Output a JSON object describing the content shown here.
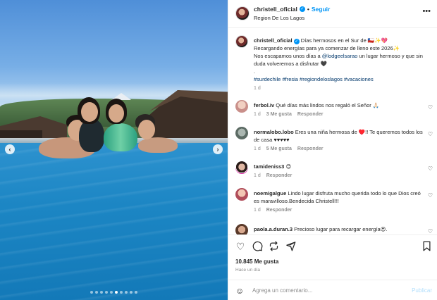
{
  "post": {
    "username": "christell_oficial",
    "follow_label": "Seguir",
    "location": "Region De Los Lagos",
    "more_icon": "more-horizontal-icon",
    "carousel": {
      "total_slides": 10,
      "active_index": 5
    }
  },
  "caption": {
    "username": "christell_oficial",
    "line1": "Días hermosos en el Sur de 🇨🇱✨💖",
    "line2": "Recargando energías para ya comenzar de lleno este 2026✨",
    "line3a": "Nos escapamos unos días a ",
    "mention": "@lodgeelsarao",
    "line3b": " un lugar hermoso y que sin duda volveremos a disfrutar 🖤",
    "dot": ".",
    "hashtags": "#surdechile #fresia #regiondeloslagos #vacaciones",
    "time": "1 d"
  },
  "comments": [
    {
      "username": "ferbol.iv",
      "text": "Qué días más lindos nos regaló el Señor 🙏🏻",
      "time": "1 d",
      "likes": "3 Me gusta",
      "reply": "Responder"
    },
    {
      "username": "normalobo.lobo",
      "text": "Eres una niña hermosa de ♥️!! Te queremos todos los de casa ♥♥♥♥♥",
      "time": "1 d",
      "likes": "5 Me gusta",
      "reply": "Responder"
    },
    {
      "username": "tamideniss3",
      "text": "😍",
      "time": "1 d",
      "likes": "",
      "reply": "Responder"
    },
    {
      "username": "noemigalgue",
      "text": "Lindo lugar disfruta mucho querida todo lo que Dios creó es maravilloso.Bendecida Christell!!!",
      "time": "1 d",
      "likes": "",
      "reply": "Responder"
    },
    {
      "username": "paola.a.duran.3",
      "text": "Precioso lugar para recargar energía😍.",
      "time": "",
      "likes": "",
      "reply": ""
    }
  ],
  "actions": {
    "likes": "10.845 Me gusta",
    "ago": "Hace un día",
    "comment_placeholder": "Agrega un comentario...",
    "publish_label": "Publicar"
  },
  "colors": {
    "link": "#0095f6",
    "tag": "#00376b",
    "muted": "#8e8e8e"
  }
}
